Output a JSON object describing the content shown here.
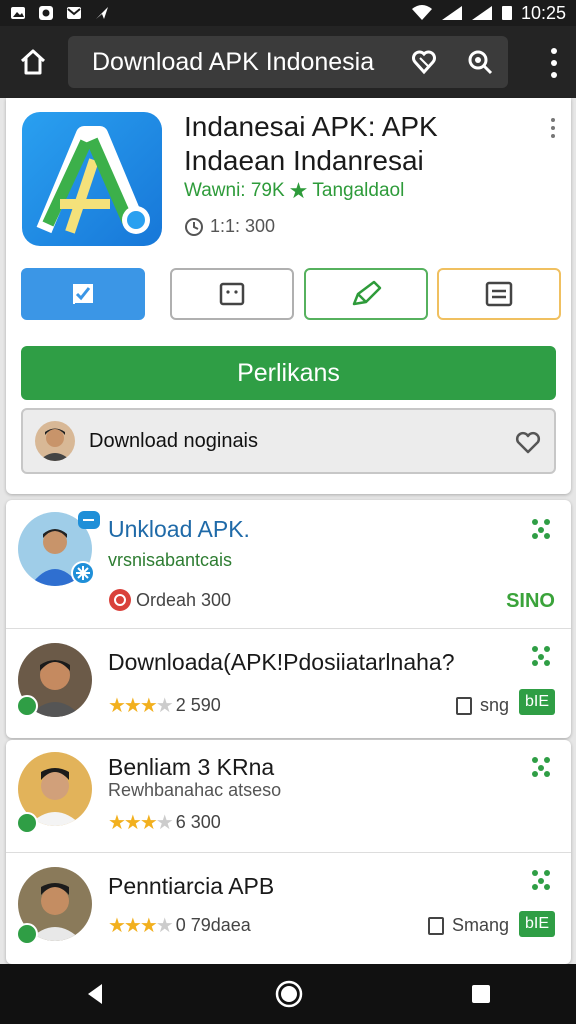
{
  "status_bar": {
    "time": "10:25"
  },
  "browser": {
    "url_title": "Download APK Indonesia"
  },
  "app": {
    "title": "Indanesai APK: APK Indaean Indanresai",
    "meta_left": "Wawni: 79K",
    "meta_right": "Tangaldaol",
    "size": "1:1: 300",
    "install_label": "Perlikans",
    "download_label": "Download noginais",
    "colors": {
      "install": "#2f9e45",
      "active_tab": "#3b96e6",
      "accent_green": "#2e9b3a"
    }
  },
  "tabs": [
    {
      "icon": "checklist-icon"
    },
    {
      "icon": "document-icon"
    },
    {
      "icon": "pencil-icon"
    },
    {
      "icon": "list-icon"
    }
  ],
  "list": [
    {
      "name": "Unkload APK.",
      "sub": "vrsnisabantcais",
      "detail": "Ordeah 300",
      "tag": "SINO"
    },
    {
      "name": "Downloada(APK!Pdosiiatarlnaha?",
      "rating_text": "2 590",
      "size": "sng",
      "tag": "bIE"
    },
    {
      "name": "Benliam 3 KRna",
      "sub": "Rewhbanahac atseso",
      "rating_text": "6 300"
    },
    {
      "name": "Penntiarcia APB",
      "rating_text": "0 79daea",
      "size": "Smang",
      "tag": "bIE"
    }
  ]
}
